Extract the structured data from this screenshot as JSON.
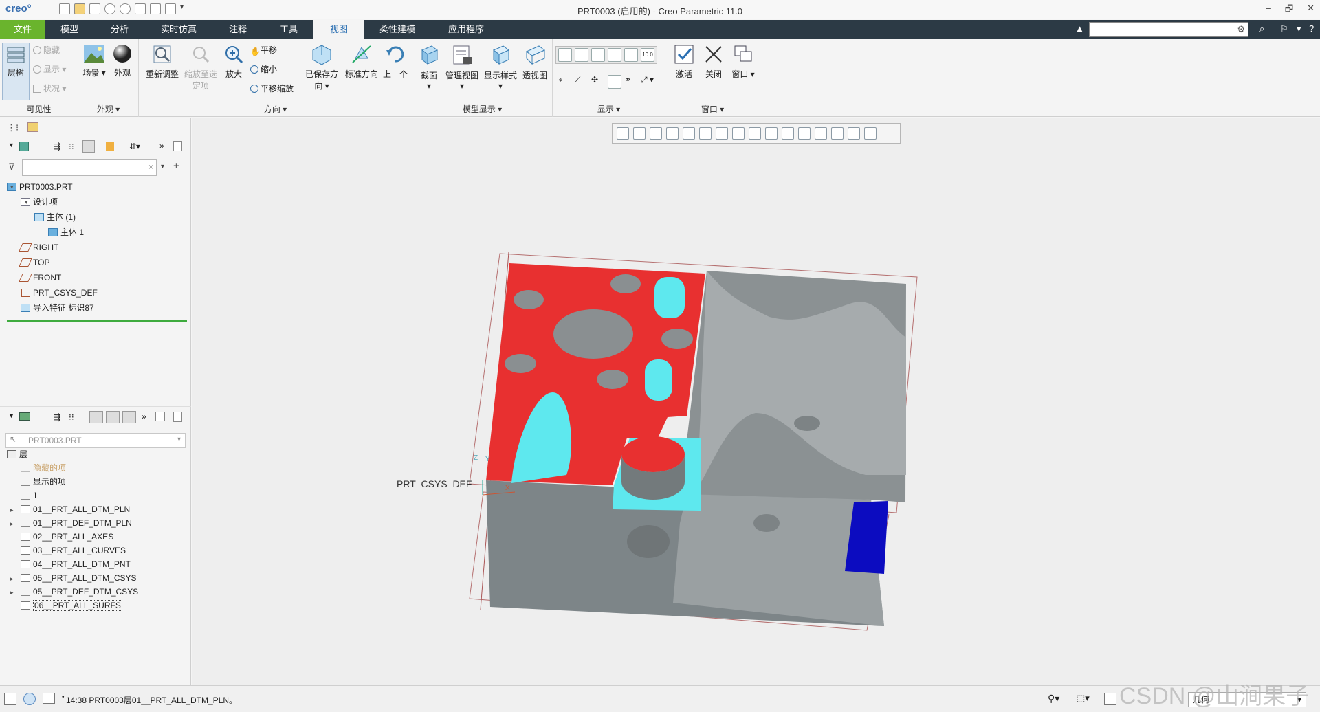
{
  "titlebar": {
    "logo": "creo°",
    "title": "PRT0003 (启用的) - Creo Parametric 11.0",
    "min": "–",
    "restore": "🗗",
    "close": "✕"
  },
  "menu_tabs": [
    "文件",
    "模型",
    "分析",
    "实时仿真",
    "注释",
    "工具",
    "视图",
    "柔性建模",
    "应用程序"
  ],
  "active_tab": "视图",
  "ribbon": {
    "visibility": {
      "label": "可见性",
      "layer_tree": "层树",
      "hide": "隐藏",
      "show": "显示",
      "status": "状况"
    },
    "appearance": {
      "label": "外观",
      "scene": "场景",
      "appearance": "外观"
    },
    "orientation": {
      "label": "方向",
      "refit": "重新调整",
      "zoom_to_selected_1": "缩放至选",
      "zoom_to_selected_2": "定项",
      "zoom_in": "放大",
      "pan": "平移",
      "zoom_out": "缩小",
      "pan_zoom": "平移缩放"
    },
    "model_display": {
      "label": "模型显示",
      "saved_orient_1": "已保存方",
      "saved_orient_2": "向",
      "standard_orient": "标准方向",
      "previous": "上一个",
      "section": "截面",
      "manage_views": "管理视图",
      "display_style": "显示样式",
      "perspective": "透视图"
    },
    "show": {
      "label": "显示",
      "plane_tag_value": "10.0"
    },
    "window": {
      "label": "窗口",
      "activate": "激活",
      "close": "关闭",
      "window": "窗口"
    }
  },
  "model_tree": {
    "items": [
      {
        "label": "PRT0003.PRT"
      },
      {
        "label": "设计项"
      },
      {
        "label": "主体 (1)"
      },
      {
        "label": "主体 1"
      },
      {
        "label": "RIGHT"
      },
      {
        "label": "TOP"
      },
      {
        "label": "FRONT"
      },
      {
        "label": "PRT_CSYS_DEF"
      },
      {
        "label": "导入特征 标识87"
      }
    ]
  },
  "layer_tree": {
    "select_value": "PRT0003.PRT",
    "root": "层",
    "items": [
      {
        "label": "隐藏的项"
      },
      {
        "label": "显示的项"
      },
      {
        "label": "1"
      },
      {
        "label": "01__PRT_ALL_DTM_PLN"
      },
      {
        "label": "01__PRT_DEF_DTM_PLN"
      },
      {
        "label": "02__PRT_ALL_AXES"
      },
      {
        "label": "03__PRT_ALL_CURVES"
      },
      {
        "label": "04__PRT_ALL_DTM_PNT"
      },
      {
        "label": "05__PRT_ALL_DTM_CSYS"
      },
      {
        "label": "05__PRT_DEF_DTM_CSYS"
      },
      {
        "label": "06__PRT_ALL_SURFS"
      }
    ]
  },
  "viewport": {
    "csys_label": "PRT_CSYS_DEF",
    "axis_y": "Y",
    "axis_z": "Z",
    "axis_x": "X"
  },
  "statusbar": {
    "message": "14:38 PRT0003层01__PRT_ALL_DTM_PLN。",
    "filter_value": "几何"
  },
  "watermark": "CSDN @山涧果子",
  "colors": {
    "accent_green": "#6ab42d",
    "tabbar": "#2c3a45",
    "active_tab_text": "#2a6fb2",
    "model_red": "#e83030",
    "model_cyan": "#5ee8ee",
    "model_blue": "#0c0cc0",
    "model_gray": "#7e8587"
  }
}
